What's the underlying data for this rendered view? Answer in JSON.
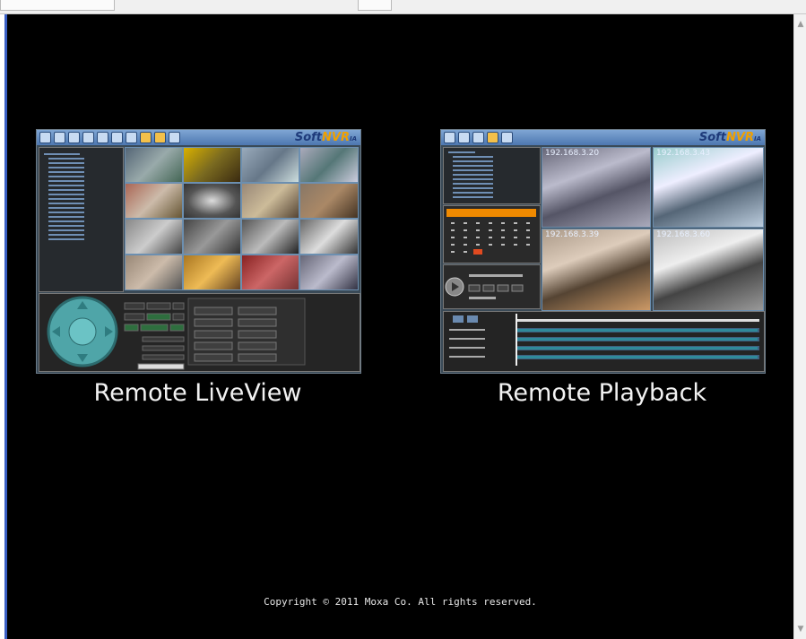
{
  "captions": {
    "liveview": "Remote LiveView",
    "playback": "Remote Playback"
  },
  "footer": {
    "copyright": "Copyright © 2011 Moxa Co. All rights reserved."
  },
  "brand": {
    "soft": "Soft",
    "nvr": "NVR",
    "ia": "IA"
  },
  "playback_cameras": [
    "192.168.3.20",
    "192.168.3.43",
    "192.168.3.39",
    "192.168.3.60"
  ],
  "colors": {
    "background": "#000000",
    "caption_text": "#f2f2f2",
    "accent_blue": "#3a5fc4"
  },
  "icons": {
    "scroll_up": "scroll-up-icon",
    "scroll_down": "scroll-down-icon"
  }
}
